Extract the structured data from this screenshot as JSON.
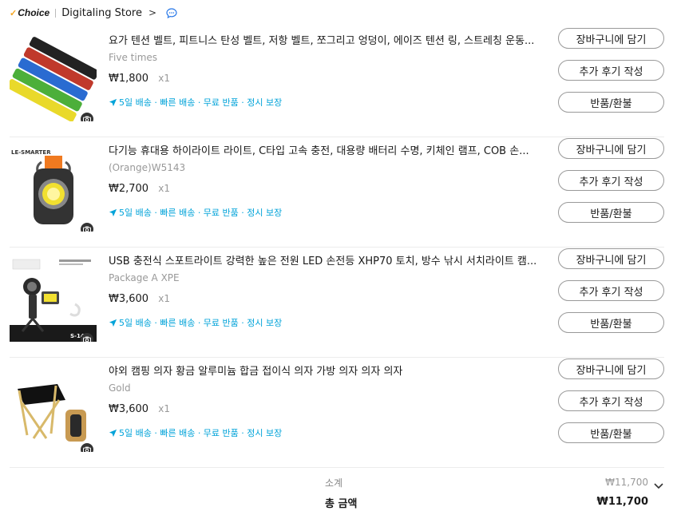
{
  "store": {
    "choice_label": "Choice",
    "name": "Digitaling Store",
    "chevron": ">",
    "icons": [
      "choice-check-icon",
      "chevron-right-icon",
      "chat-bubble-icon"
    ]
  },
  "items": [
    {
      "title": "요가 텐션 벨트, 피트니스 탄성 벨트, 저항 벨트, 쪼그리고 엉덩이, 에이즈 텐션 링, 스트레칭 운동...",
      "variant": "Five times",
      "price": "₩1,800",
      "qty": "x1",
      "shipping": "5일 배송 · 빠른 배송 · 무료 반품 · 정시 보장",
      "buttons": [
        "장바구니에 담기",
        "추가 후기 작성",
        "반품/환불"
      ]
    },
    {
      "title": "다기능 휴대용 하이라이트 라이트, C타입 고속 충전, 대용량 배터리 수명, 키체인 램프, COB 손...",
      "variant": "(Orange)W5143",
      "price": "₩2,700",
      "qty": "x1",
      "shipping": "5일 배송 · 빠른 배송 · 무료 반품 · 정시 보장",
      "buttons": [
        "장바구니에 담기",
        "추가 후기 작성",
        "반품/환불"
      ]
    },
    {
      "title": "USB 충전식 스포트라이트 강력한 높은 전원 LED 손전등 XHP70 토치, 방수 낚시 서치라이트 캠...",
      "variant": "Package A XPE",
      "price": "₩3,600",
      "qty": "x1",
      "shipping": "5일 배송 · 빠른 배송 · 무료 반품 · 정시 보장",
      "buttons": [
        "장바구니에 담기",
        "추가 후기 작성",
        "반품/환불"
      ]
    },
    {
      "title": "야외 캠핑 의자 황금 알루미늄 합금 접이식 의자 가방 의자 의자 의자",
      "variant": "Gold",
      "price": "₩3,600",
      "qty": "x1",
      "shipping": "5일 배송 · 빠른 배송 · 무료 반품 · 정시 보장",
      "buttons": [
        "장바구니에 담기",
        "추가 후기 작성",
        "반품/환불"
      ]
    }
  ],
  "thumb_labels": {
    "flashlight": "LE-SMARTER",
    "spotlight_badge": "S-14"
  },
  "summary": {
    "subtotal_label": "소계",
    "subtotal_value": "₩11,700",
    "total_label": "총 금액",
    "total_value": "₩11,700"
  },
  "colors": {
    "shipping_blue": "#00a3d9",
    "choice_check": "#f5a623",
    "chat_icon": "#2a79e8",
    "button_border": "#999999"
  }
}
